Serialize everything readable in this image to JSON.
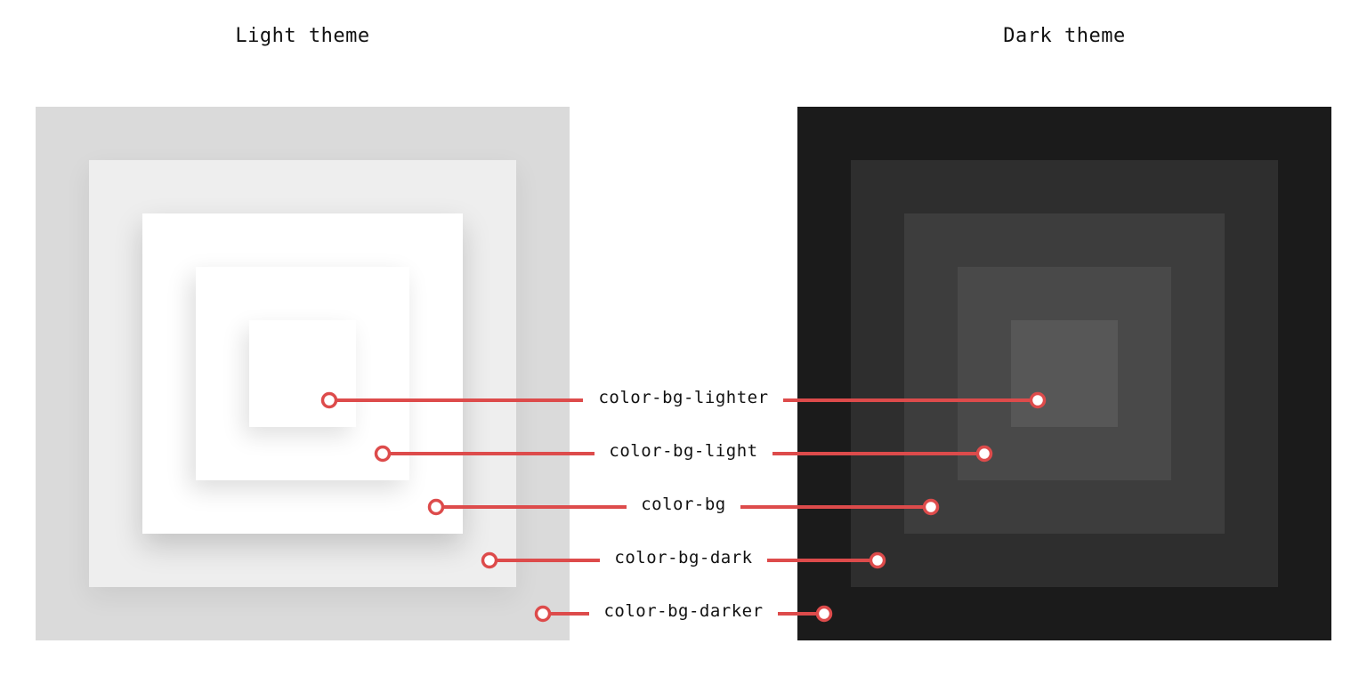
{
  "titles": {
    "light": "Light theme",
    "dark": "Dark theme"
  },
  "colors": {
    "accent": "#dd4b4b",
    "light": {
      "color-bg-darker": "#dadada",
      "color-bg-dark": "#eeeeee",
      "color-bg": "#ffffff",
      "color-bg-light": "#ffffff",
      "color-bg-lighter": "#ffffff"
    },
    "dark": {
      "color-bg-darker": "#1b1b1b",
      "color-bg-dark": "#2e2e2e",
      "color-bg": "#3d3d3d",
      "color-bg-light": "#494949",
      "color-bg-lighter": "#575757"
    }
  },
  "tokens": [
    "color-bg-lighter",
    "color-bg-light",
    "color-bg",
    "color-bg-dark",
    "color-bg-darker"
  ]
}
